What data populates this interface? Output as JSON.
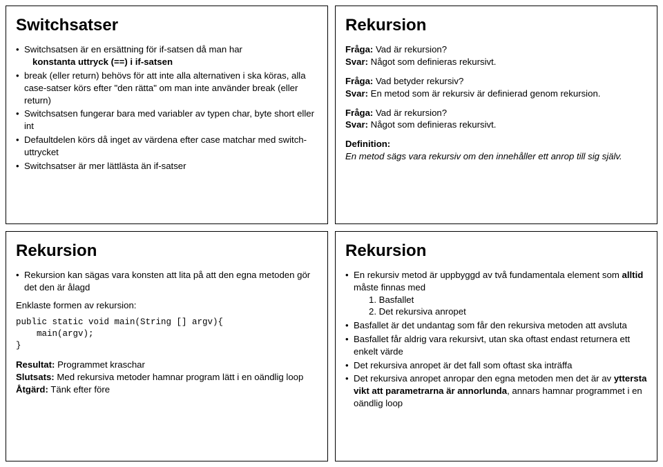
{
  "panels": {
    "switchsatser": {
      "title": "Switchsatser",
      "items": [
        "Switchsatsen är en ersättning för if-satsen då man har",
        "break (eller return) behövs för att inte alla alternativen i ska köras, alla case-satser körs efter \"den rätta\" om man inte använder break (eller return)",
        "Switchsatsen fungerar bara med variabler av typen char, byte short eller int",
        "Defaultdelen körs då inget av värdena efter case matchar med switch-uttrycket",
        "Switchsatser är mer lättlästa än if-satser"
      ],
      "sub_after_first": "konstanta uttryck (==) i if-satsen"
    },
    "rekursion_qa": {
      "title": "Rekursion",
      "q1_label": "Fråga:",
      "q1": "Vad är rekursion?",
      "a1_label": "Svar:",
      "a1": "Något som definieras rekursivt.",
      "q2_label": "Fråga:",
      "q2": "Vad betyder rekursiv?",
      "a2_label": "Svar:",
      "a2": "En metod som är rekursiv är definierad genom rekursion.",
      "q3_label": "Fråga:",
      "q3": "Vad är rekursion?",
      "a3_label": "Svar:",
      "a3": "Något som definieras rekursivt.",
      "def_label": "Definition:",
      "def_text": "En metod sägs vara rekursiv om den innehåller ett anrop till sig själv."
    },
    "rekursion_code": {
      "title": "Rekursion",
      "bullet": "Rekursion kan sägas vara konsten att lita på att den egna metoden gör det den är ålagd",
      "intro": "Enklaste formen av rekursion:",
      "code_l1": "public static void main(String [] argv){",
      "code_l2": "    main(argv);",
      "code_l3": "}",
      "res_label": "Resultat:",
      "res": "Programmet kraschar",
      "slut_label": "Slutsats:",
      "slut": "Med rekursiva metoder hamnar program lätt i en oändlig loop",
      "act_label": "Åtgärd:",
      "act": "Tänk efter före"
    },
    "rekursion_struct": {
      "title": "Rekursion",
      "b1_pre": "En rekursiv metod är uppbyggd av två fundamentala element som ",
      "b1_bold": "alltid",
      "b1_post": " måste finnas med",
      "sub1": "1. Basfallet",
      "sub2": "2. Det rekursiva anropet",
      "b2": "Basfallet är det undantag som får den rekursiva metoden att avsluta",
      "b3": "Basfallet får aldrig vara rekursivt, utan ska oftast endast returnera ett enkelt värde",
      "b4": "Det rekursiva anropet är det fall som oftast ska inträffa",
      "b5_pre": "Det rekursiva anropet anropar den egna metoden men det är av ",
      "b5_bold": "yttersta vikt att parametrarna är annorlunda",
      "b5_post": ", annars hamnar programmet i en oändlig loop"
    }
  }
}
